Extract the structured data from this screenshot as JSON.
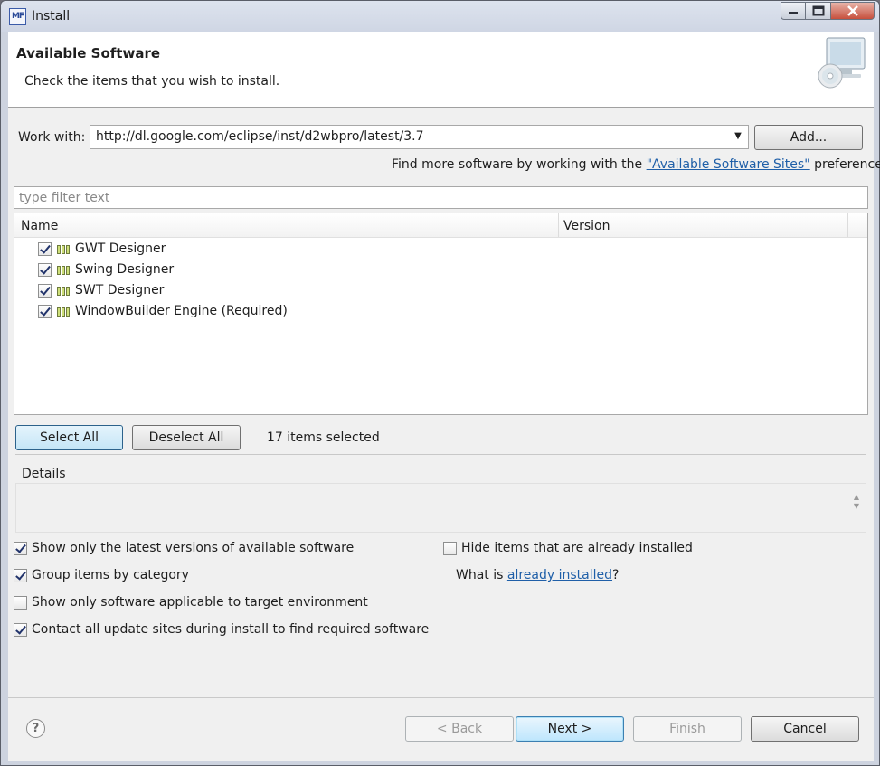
{
  "window": {
    "title": "Install",
    "app_icon_text": "MF"
  },
  "banner": {
    "title": "Available Software",
    "description": "Check the items that you wish to install.",
    "graphic_icon": "computer-cd-icon"
  },
  "work_with": {
    "label": "Work with:",
    "value": "http://dl.google.com/eclipse/inst/d2wbpro/latest/3.7",
    "add_button": "Add...",
    "hint_prefix": "Find more software by working with the ",
    "hint_link": "\"Available Software Sites\"",
    "hint_suffix": " preferences."
  },
  "filter": {
    "placeholder": "type filter text"
  },
  "tree": {
    "columns": [
      "Name",
      "Version"
    ],
    "items": [
      {
        "name": "GWT Designer",
        "checked": true
      },
      {
        "name": "Swing Designer",
        "checked": true
      },
      {
        "name": "SWT Designer",
        "checked": true
      },
      {
        "name": "WindowBuilder Engine (Required)",
        "checked": true
      }
    ]
  },
  "selection": {
    "select_all": "Select All",
    "deselect_all": "Deselect All",
    "count_text": "17 items selected"
  },
  "details": {
    "label": "Details"
  },
  "options": {
    "latest_versions": {
      "label": "Show only the latest versions of available software",
      "checked": true
    },
    "group_by_category": {
      "label": "Group items by category",
      "checked": true
    },
    "target_env": {
      "label": "Show only software applicable to target environment",
      "checked": false
    },
    "contact_sites": {
      "label": "Contact all update sites during install to find required software",
      "checked": true
    },
    "hide_installed": {
      "label": "Hide items that are already installed",
      "checked": false
    },
    "what_is_prefix": "What is ",
    "what_is_link": "already installed",
    "what_is_suffix": "?"
  },
  "footer": {
    "back": "< Back",
    "next": "Next >",
    "finish": "Finish",
    "cancel": "Cancel",
    "help_icon": "help-icon"
  }
}
